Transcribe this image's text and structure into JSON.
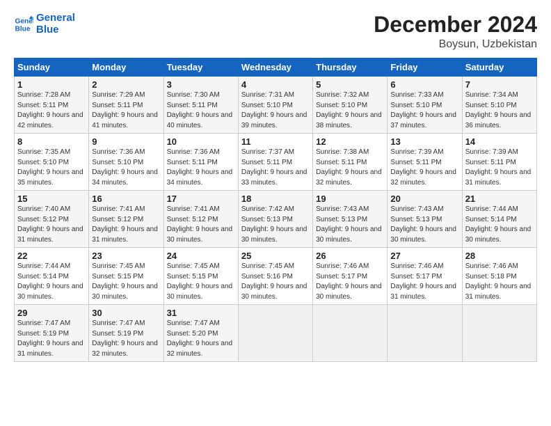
{
  "logo": {
    "line1": "General",
    "line2": "Blue"
  },
  "title": "December 2024",
  "subtitle": "Boysun, Uzbekistan",
  "weekdays": [
    "Sunday",
    "Monday",
    "Tuesday",
    "Wednesday",
    "Thursday",
    "Friday",
    "Saturday"
  ],
  "weeks": [
    [
      {
        "day": "1",
        "sunrise": "Sunrise: 7:28 AM",
        "sunset": "Sunset: 5:11 PM",
        "daylight": "Daylight: 9 hours and 42 minutes."
      },
      {
        "day": "2",
        "sunrise": "Sunrise: 7:29 AM",
        "sunset": "Sunset: 5:11 PM",
        "daylight": "Daylight: 9 hours and 41 minutes."
      },
      {
        "day": "3",
        "sunrise": "Sunrise: 7:30 AM",
        "sunset": "Sunset: 5:11 PM",
        "daylight": "Daylight: 9 hours and 40 minutes."
      },
      {
        "day": "4",
        "sunrise": "Sunrise: 7:31 AM",
        "sunset": "Sunset: 5:10 PM",
        "daylight": "Daylight: 9 hours and 39 minutes."
      },
      {
        "day": "5",
        "sunrise": "Sunrise: 7:32 AM",
        "sunset": "Sunset: 5:10 PM",
        "daylight": "Daylight: 9 hours and 38 minutes."
      },
      {
        "day": "6",
        "sunrise": "Sunrise: 7:33 AM",
        "sunset": "Sunset: 5:10 PM",
        "daylight": "Daylight: 9 hours and 37 minutes."
      },
      {
        "day": "7",
        "sunrise": "Sunrise: 7:34 AM",
        "sunset": "Sunset: 5:10 PM",
        "daylight": "Daylight: 9 hours and 36 minutes."
      }
    ],
    [
      {
        "day": "8",
        "sunrise": "Sunrise: 7:35 AM",
        "sunset": "Sunset: 5:10 PM",
        "daylight": "Daylight: 9 hours and 35 minutes."
      },
      {
        "day": "9",
        "sunrise": "Sunrise: 7:36 AM",
        "sunset": "Sunset: 5:10 PM",
        "daylight": "Daylight: 9 hours and 34 minutes."
      },
      {
        "day": "10",
        "sunrise": "Sunrise: 7:36 AM",
        "sunset": "Sunset: 5:11 PM",
        "daylight": "Daylight: 9 hours and 34 minutes."
      },
      {
        "day": "11",
        "sunrise": "Sunrise: 7:37 AM",
        "sunset": "Sunset: 5:11 PM",
        "daylight": "Daylight: 9 hours and 33 minutes."
      },
      {
        "day": "12",
        "sunrise": "Sunrise: 7:38 AM",
        "sunset": "Sunset: 5:11 PM",
        "daylight": "Daylight: 9 hours and 32 minutes."
      },
      {
        "day": "13",
        "sunrise": "Sunrise: 7:39 AM",
        "sunset": "Sunset: 5:11 PM",
        "daylight": "Daylight: 9 hours and 32 minutes."
      },
      {
        "day": "14",
        "sunrise": "Sunrise: 7:39 AM",
        "sunset": "Sunset: 5:11 PM",
        "daylight": "Daylight: 9 hours and 31 minutes."
      }
    ],
    [
      {
        "day": "15",
        "sunrise": "Sunrise: 7:40 AM",
        "sunset": "Sunset: 5:12 PM",
        "daylight": "Daylight: 9 hours and 31 minutes."
      },
      {
        "day": "16",
        "sunrise": "Sunrise: 7:41 AM",
        "sunset": "Sunset: 5:12 PM",
        "daylight": "Daylight: 9 hours and 31 minutes."
      },
      {
        "day": "17",
        "sunrise": "Sunrise: 7:41 AM",
        "sunset": "Sunset: 5:12 PM",
        "daylight": "Daylight: 9 hours and 30 minutes."
      },
      {
        "day": "18",
        "sunrise": "Sunrise: 7:42 AM",
        "sunset": "Sunset: 5:13 PM",
        "daylight": "Daylight: 9 hours and 30 minutes."
      },
      {
        "day": "19",
        "sunrise": "Sunrise: 7:43 AM",
        "sunset": "Sunset: 5:13 PM",
        "daylight": "Daylight: 9 hours and 30 minutes."
      },
      {
        "day": "20",
        "sunrise": "Sunrise: 7:43 AM",
        "sunset": "Sunset: 5:13 PM",
        "daylight": "Daylight: 9 hours and 30 minutes."
      },
      {
        "day": "21",
        "sunrise": "Sunrise: 7:44 AM",
        "sunset": "Sunset: 5:14 PM",
        "daylight": "Daylight: 9 hours and 30 minutes."
      }
    ],
    [
      {
        "day": "22",
        "sunrise": "Sunrise: 7:44 AM",
        "sunset": "Sunset: 5:14 PM",
        "daylight": "Daylight: 9 hours and 30 minutes."
      },
      {
        "day": "23",
        "sunrise": "Sunrise: 7:45 AM",
        "sunset": "Sunset: 5:15 PM",
        "daylight": "Daylight: 9 hours and 30 minutes."
      },
      {
        "day": "24",
        "sunrise": "Sunrise: 7:45 AM",
        "sunset": "Sunset: 5:15 PM",
        "daylight": "Daylight: 9 hours and 30 minutes."
      },
      {
        "day": "25",
        "sunrise": "Sunrise: 7:45 AM",
        "sunset": "Sunset: 5:16 PM",
        "daylight": "Daylight: 9 hours and 30 minutes."
      },
      {
        "day": "26",
        "sunrise": "Sunrise: 7:46 AM",
        "sunset": "Sunset: 5:17 PM",
        "daylight": "Daylight: 9 hours and 30 minutes."
      },
      {
        "day": "27",
        "sunrise": "Sunrise: 7:46 AM",
        "sunset": "Sunset: 5:17 PM",
        "daylight": "Daylight: 9 hours and 31 minutes."
      },
      {
        "day": "28",
        "sunrise": "Sunrise: 7:46 AM",
        "sunset": "Sunset: 5:18 PM",
        "daylight": "Daylight: 9 hours and 31 minutes."
      }
    ],
    [
      {
        "day": "29",
        "sunrise": "Sunrise: 7:47 AM",
        "sunset": "Sunset: 5:19 PM",
        "daylight": "Daylight: 9 hours and 31 minutes."
      },
      {
        "day": "30",
        "sunrise": "Sunrise: 7:47 AM",
        "sunset": "Sunset: 5:19 PM",
        "daylight": "Daylight: 9 hours and 32 minutes."
      },
      {
        "day": "31",
        "sunrise": "Sunrise: 7:47 AM",
        "sunset": "Sunset: 5:20 PM",
        "daylight": "Daylight: 9 hours and 32 minutes."
      },
      null,
      null,
      null,
      null
    ]
  ]
}
